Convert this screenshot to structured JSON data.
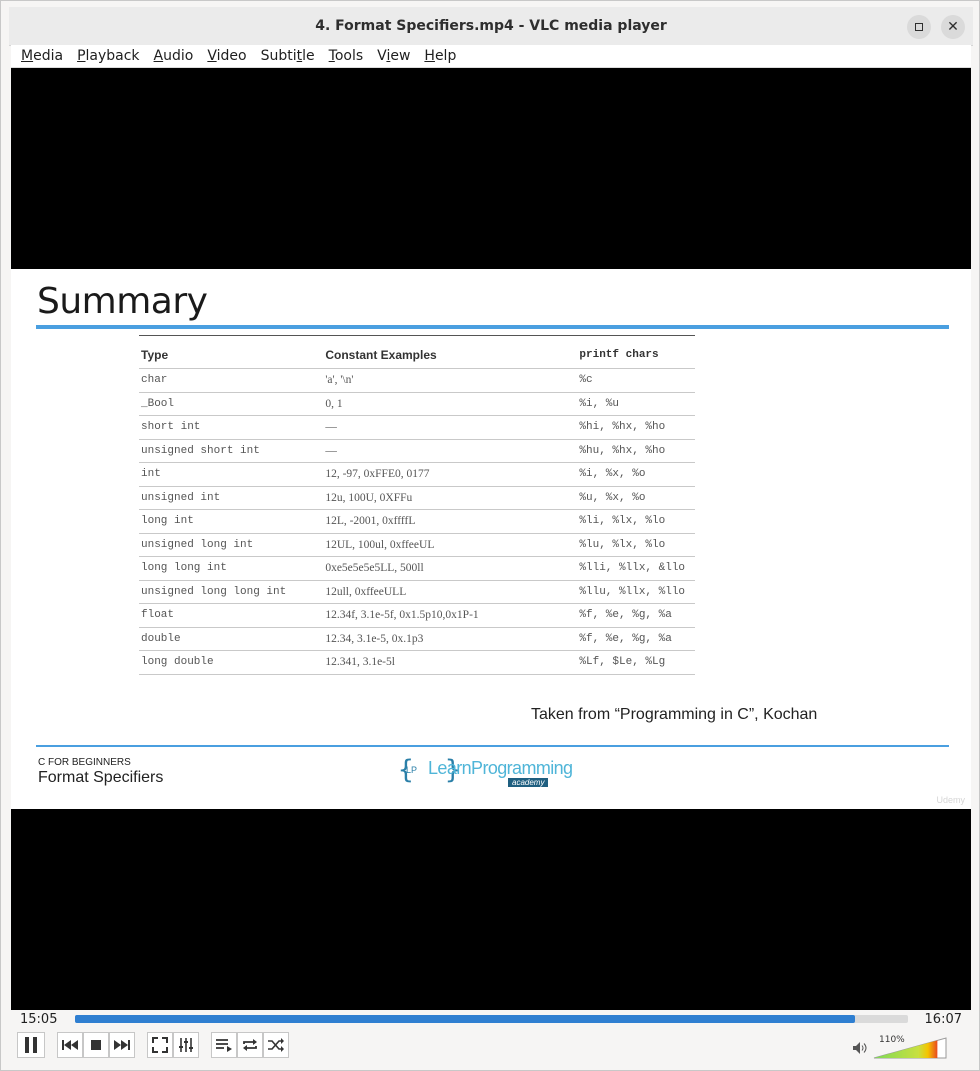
{
  "window": {
    "title": "4. Format Specifiers.mp4 - VLC media player"
  },
  "menubar": {
    "items": [
      {
        "pre": "",
        "u": "M",
        "post": "edia"
      },
      {
        "pre": "",
        "u": "P",
        "post": "layback"
      },
      {
        "pre": "",
        "u": "A",
        "post": "udio"
      },
      {
        "pre": "",
        "u": "V",
        "post": "ideo"
      },
      {
        "pre": "Subti",
        "u": "t",
        "post": "le"
      },
      {
        "pre": "",
        "u": "T",
        "post": "ools"
      },
      {
        "pre": "V",
        "u": "i",
        "post": "ew"
      },
      {
        "pre": "",
        "u": "H",
        "post": "elp"
      }
    ]
  },
  "slide": {
    "title": "Summary",
    "table": {
      "headers": [
        "Type",
        "Constant Examples",
        "printf chars"
      ],
      "rows": [
        [
          "char",
          "'a', '\\n'",
          "%c"
        ],
        [
          "_Bool",
          "0, 1",
          "%i, %u"
        ],
        [
          "short int",
          "—",
          "%hi, %hx, %ho"
        ],
        [
          "unsigned short int",
          "—",
          "%hu, %hx, %ho"
        ],
        [
          "int",
          "12, -97, 0xFFE0, 0177",
          "%i, %x, %o"
        ],
        [
          "unsigned int",
          "12u, 100U, 0XFFu",
          "%u, %x, %o"
        ],
        [
          "long int",
          "12L, -2001, 0xffffL",
          "%li, %lx, %lo"
        ],
        [
          "unsigned long int",
          "12UL, 100ul, 0xffeeUL",
          "%lu, %lx, %lo"
        ],
        [
          "long long int",
          "0xe5e5e5e5LL, 500ll",
          "%lli, %llx, &llo"
        ],
        [
          "unsigned long long int",
          "12ull, 0xffeeULL",
          "%llu, %llx, %llo"
        ],
        [
          "float",
          "12.34f, 3.1e-5f,  0x1.5p10,0x1P-1",
          "%f, %e, %g,  %a"
        ],
        [
          "double",
          "12.34, 3.1e-5,  0x.1p3",
          "%f, %e, %g,  %a"
        ],
        [
          "long double",
          "12.341, 3.1e-5l",
          "%Lf, $Le, %Lg"
        ]
      ]
    },
    "credit": "Taken from “Programming in C”, Kochan",
    "course_small": "C FOR BEGINNERS",
    "course_big": "Format Specifiers",
    "logo": {
      "brace": "{",
      "lp": "LP",
      "brace_close": "}",
      "word": "LearnProgramming",
      "sub": "academy"
    },
    "watermark": "Udemy"
  },
  "player": {
    "current_time": "15:05",
    "total_time": "16:07",
    "progress": 0.936,
    "volume_label": "110%",
    "volume": 1.1,
    "accent": "#2f7fd1"
  }
}
